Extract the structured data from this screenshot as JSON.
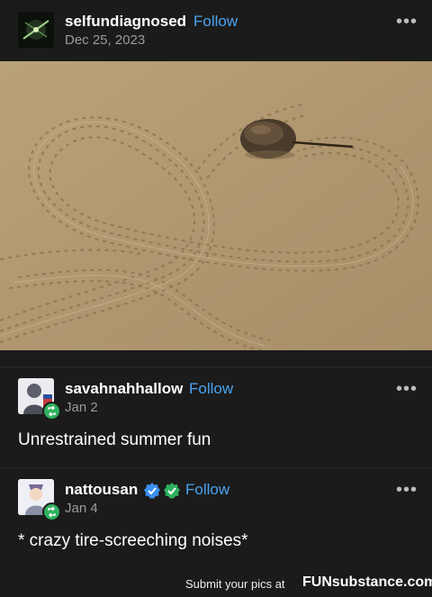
{
  "post": {
    "username": "selfundiagnosed",
    "follow_label": "Follow",
    "date": "Dec 25, 2023",
    "more_icon": "more-horizontal-icon"
  },
  "reblogs": [
    {
      "username": "savahnahhallow",
      "follow_label": "Follow",
      "date": "Jan 2",
      "text": "Unrestrained summer fun"
    },
    {
      "username": "nattousan",
      "follow_label": "Follow",
      "date": "Jan 4",
      "text": "* crazy tire-screeching noises*"
    }
  ],
  "footer": {
    "text": "Submit your pics at",
    "brand": "FUNsubstance.com"
  },
  "colors": {
    "background": "#1b1b1b",
    "follow": "#4aa4f0",
    "reblog_badge": "#2fb15e",
    "verified": "#3b8ff0",
    "sand": "#b79f75"
  }
}
